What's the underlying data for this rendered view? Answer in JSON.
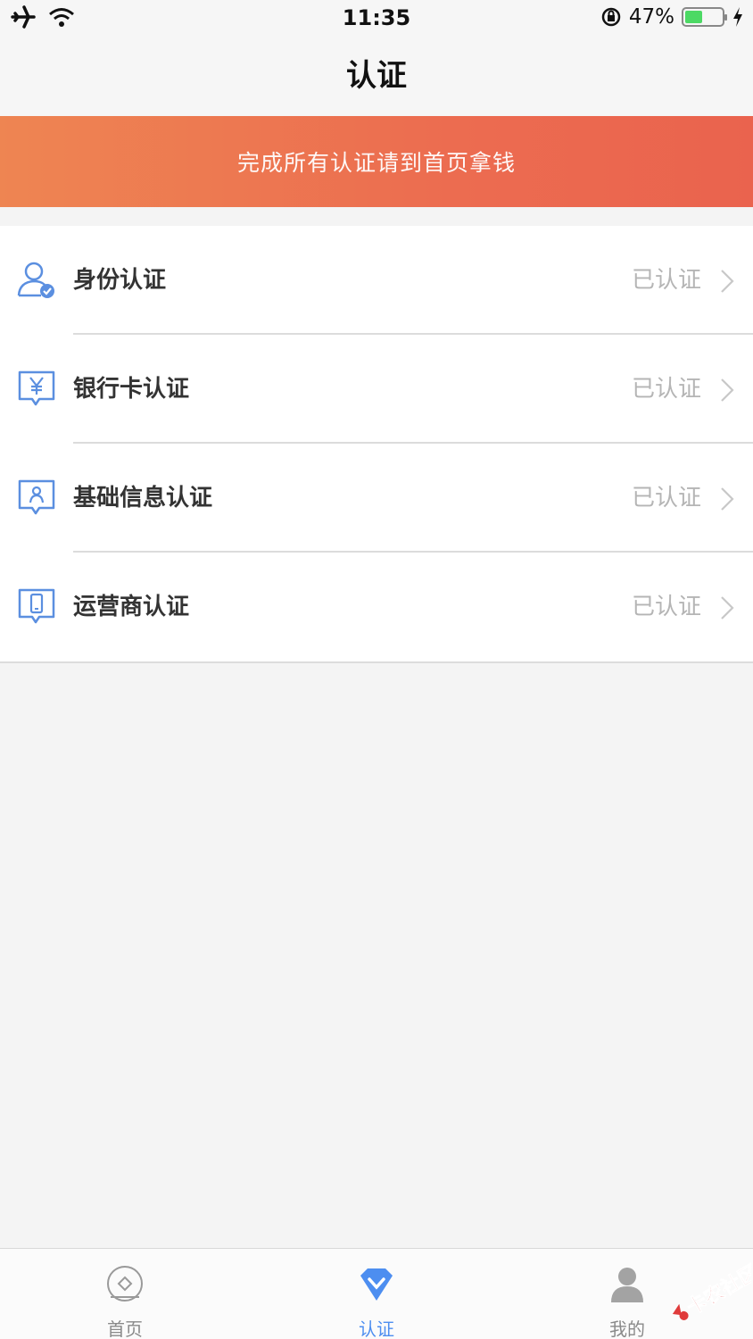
{
  "status_bar": {
    "time": "11:35",
    "battery_percent": "47%",
    "battery_level": 0.47,
    "icons": [
      "airplane-icon",
      "wifi-icon",
      "rotation-lock-icon",
      "battery-icon",
      "charging-bolt-icon"
    ]
  },
  "nav": {
    "title": "认证"
  },
  "banner": {
    "text": "完成所有认证请到首页拿钱"
  },
  "verifications": [
    {
      "label": "身份认证",
      "status": "已认证",
      "icon": "user-check-icon"
    },
    {
      "label": "银行卡认证",
      "status": "已认证",
      "icon": "bank-card-yen-icon"
    },
    {
      "label": "基础信息认证",
      "status": "已认证",
      "icon": "profile-card-icon"
    },
    {
      "label": "运营商认证",
      "status": "已认证",
      "icon": "mobile-phone-icon"
    }
  ],
  "tabs": [
    {
      "label": "首页",
      "icon": "home-diamond-icon",
      "active": false
    },
    {
      "label": "认证",
      "icon": "verify-diamond-icon",
      "active": true
    },
    {
      "label": "我的",
      "icon": "person-icon",
      "active": false
    }
  ],
  "watermark": {
    "text": "卡农社区"
  },
  "colors": {
    "accent": "#4d8ef0",
    "banner_start": "#ee8552",
    "banner_end": "#ea634e",
    "icon_blue": "#5b8fe0",
    "muted": "#b5b5b5"
  }
}
